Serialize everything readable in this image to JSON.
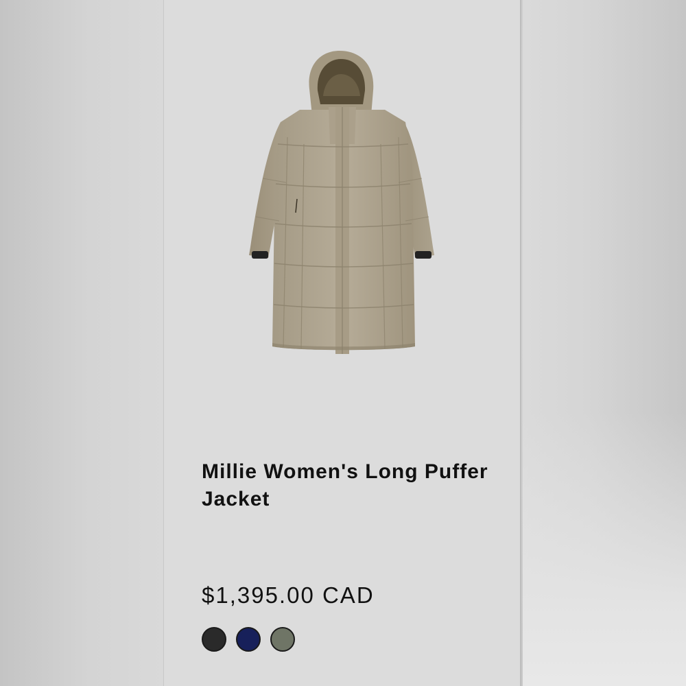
{
  "product": {
    "title": "Millie Women's Long Puffer Jacket",
    "price": "$1,395.00 CAD",
    "image_icon": "long-puffer-jacket-image",
    "swatches": [
      {
        "name": "black",
        "color": "#2a2a2a"
      },
      {
        "name": "navy",
        "color": "#17205a"
      },
      {
        "name": "olive",
        "color": "#6f7566"
      }
    ]
  }
}
